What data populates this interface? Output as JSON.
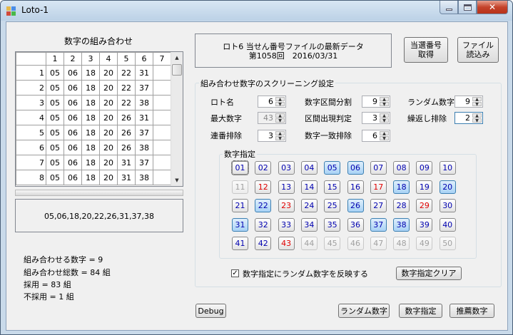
{
  "window": {
    "title": "Loto-1"
  },
  "left": {
    "grid_title": "数字の組み合わせ",
    "columns": [
      "1",
      "2",
      "3",
      "4",
      "5",
      "6",
      "7"
    ],
    "rows": [
      {
        "n": "1",
        "c": [
          "05",
          "06",
          "18",
          "20",
          "22",
          "31",
          ""
        ]
      },
      {
        "n": "2",
        "c": [
          "05",
          "06",
          "18",
          "20",
          "22",
          "37",
          ""
        ]
      },
      {
        "n": "3",
        "c": [
          "05",
          "06",
          "18",
          "20",
          "22",
          "38",
          ""
        ]
      },
      {
        "n": "4",
        "c": [
          "05",
          "06",
          "18",
          "20",
          "26",
          "31",
          ""
        ]
      },
      {
        "n": "5",
        "c": [
          "05",
          "06",
          "18",
          "20",
          "26",
          "37",
          ""
        ]
      },
      {
        "n": "6",
        "c": [
          "05",
          "06",
          "18",
          "20",
          "26",
          "38",
          ""
        ]
      },
      {
        "n": "7",
        "c": [
          "05",
          "06",
          "18",
          "20",
          "31",
          "37",
          ""
        ]
      },
      {
        "n": "8",
        "c": [
          "05",
          "06",
          "18",
          "20",
          "31",
          "38",
          ""
        ]
      }
    ],
    "selected_text": "05,06,18,20,22,26,31,37,38",
    "stats": [
      "組み合わせる数字 = 9",
      "組み合わせ総数 = 84 組",
      "採用 = 83 組",
      "不採用 = 1 組"
    ]
  },
  "info": {
    "line1": "ロト6 当せん番号ファイルの最新データ",
    "line2": "第1058回　2016/03/31"
  },
  "buttons": {
    "fetch": "当選番号\n取得",
    "load": "ファイル\n読込み",
    "debug": "Debug",
    "random": "ランダム数字",
    "numspec": "数字指定",
    "recommend": "推薦数字",
    "clear": "数字指定クリア"
  },
  "screening": {
    "title": "組み合わせ数字のスクリーニング設定",
    "fields": [
      {
        "label": "ロト名",
        "value": "6",
        "disabled": false
      },
      {
        "label": "最大数字",
        "value": "43",
        "disabled": true
      },
      {
        "label": "連番排除",
        "value": "3",
        "disabled": false
      },
      {
        "label": "数字区間分割",
        "value": "9",
        "disabled": false
      },
      {
        "label": "区間出現判定",
        "value": "3",
        "disabled": false
      },
      {
        "label": "数字一致排除",
        "value": "6",
        "disabled": false
      },
      {
        "label": "ランダム数字",
        "value": "9",
        "disabled": false
      },
      {
        "label": "繰返し排除",
        "value": "2",
        "disabled": false
      }
    ],
    "numspec_title": "数字指定",
    "numbers": [
      {
        "t": "01",
        "s": 1
      },
      {
        "t": "02",
        "s": 0
      },
      {
        "t": "03",
        "s": 0
      },
      {
        "t": "04",
        "s": 0
      },
      {
        "t": "05",
        "s": 2
      },
      {
        "t": "06",
        "s": 2
      },
      {
        "t": "07",
        "s": 0
      },
      {
        "t": "08",
        "s": 0
      },
      {
        "t": "09",
        "s": 0
      },
      {
        "t": "10",
        "s": 0
      },
      {
        "t": "11",
        "s": 3
      },
      {
        "t": "12",
        "s": 4
      },
      {
        "t": "13",
        "s": 0
      },
      {
        "t": "14",
        "s": 0
      },
      {
        "t": "15",
        "s": 0
      },
      {
        "t": "16",
        "s": 0
      },
      {
        "t": "17",
        "s": 4
      },
      {
        "t": "18",
        "s": 2
      },
      {
        "t": "19",
        "s": 0
      },
      {
        "t": "20",
        "s": 2
      },
      {
        "t": "21",
        "s": 0
      },
      {
        "t": "22",
        "s": 2
      },
      {
        "t": "23",
        "s": 4
      },
      {
        "t": "24",
        "s": 0
      },
      {
        "t": "25",
        "s": 0
      },
      {
        "t": "26",
        "s": 2
      },
      {
        "t": "27",
        "s": 0
      },
      {
        "t": "28",
        "s": 0
      },
      {
        "t": "29",
        "s": 4
      },
      {
        "t": "30",
        "s": 0
      },
      {
        "t": "31",
        "s": 2
      },
      {
        "t": "32",
        "s": 0
      },
      {
        "t": "33",
        "s": 0
      },
      {
        "t": "34",
        "s": 0
      },
      {
        "t": "35",
        "s": 0
      },
      {
        "t": "36",
        "s": 0
      },
      {
        "t": "37",
        "s": 2
      },
      {
        "t": "38",
        "s": 2
      },
      {
        "t": "39",
        "s": 0
      },
      {
        "t": "40",
        "s": 0
      },
      {
        "t": "41",
        "s": 0
      },
      {
        "t": "42",
        "s": 0
      },
      {
        "t": "43",
        "s": 4
      },
      {
        "t": "44",
        "s": 3
      },
      {
        "t": "45",
        "s": 3
      },
      {
        "t": "46",
        "s": 3
      },
      {
        "t": "47",
        "s": 3
      },
      {
        "t": "48",
        "s": 3
      },
      {
        "t": "49",
        "s": 3
      },
      {
        "t": "50",
        "s": 3
      }
    ],
    "checkbox_label": "数字指定にランダム数字を反映する",
    "checkbox_checked": "✓"
  },
  "colors": {
    "accent": "#3c7fb1",
    "red": "#e00000",
    "blue_text": "#0000b0",
    "selected_fill": "#a8d2f5"
  }
}
